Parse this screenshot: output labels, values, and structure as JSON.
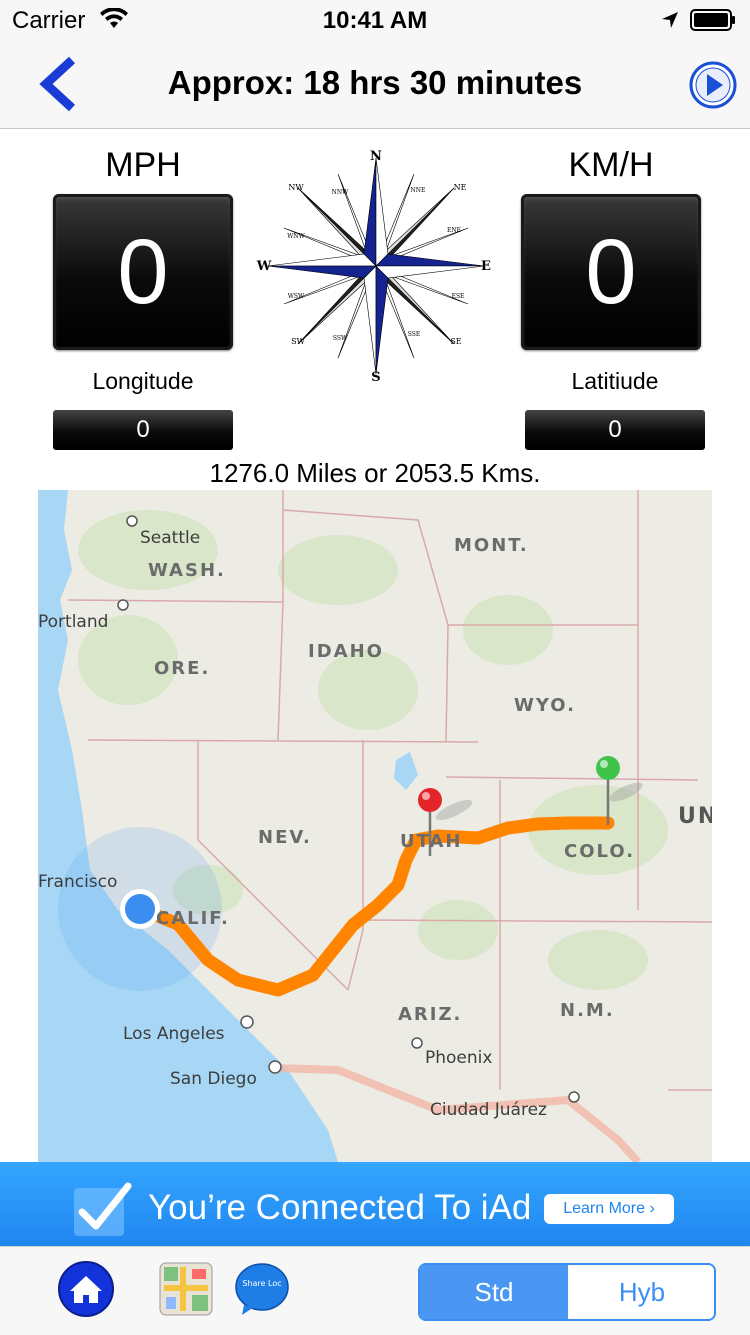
{
  "status_bar": {
    "carrier": "Carrier",
    "time": "10:41 AM",
    "icons": [
      "wifi-icon",
      "location-arrow-icon",
      "battery-icon"
    ]
  },
  "nav": {
    "title": "Approx: 18 hrs 30 minutes",
    "back_icon": "chevron-left-icon",
    "play_icon": "play-icon",
    "accent_color": "#1a3bd6"
  },
  "speed": {
    "mph_label": "MPH",
    "mph_value": "0",
    "kmh_label": "KM/H",
    "kmh_value": "0"
  },
  "coords": {
    "longitude_label": "Longitude",
    "longitude_value": "0",
    "latitude_label": "Latitiude",
    "latitude_value": "0"
  },
  "compass": {
    "cardinals": {
      "n": "N",
      "s": "S",
      "e": "E",
      "w": "W"
    },
    "intercardinals": {
      "ne": "NE",
      "nw": "NW",
      "se": "SE",
      "sw": "SW"
    },
    "minor": {
      "nne": "NNE",
      "ene": "ENE",
      "ese": "ESE",
      "sse": "SSE",
      "ssw": "SSW",
      "wsw": "WSW",
      "wnw": "WNW",
      "nnw": "NNW"
    }
  },
  "distance_text": "1276.0 Miles or 2053.5 Kms.",
  "map": {
    "states": {
      "wash": "WASH.",
      "ore": "ORE.",
      "idaho": "IDAHO",
      "mont": "MONT.",
      "wyo": "WYO.",
      "nev": "NEV.",
      "utah": "UTAH",
      "colo": "COLO.",
      "calif": "CALIF.",
      "ariz": "ARIZ.",
      "nm": "N.M.",
      "un": "UN"
    },
    "cities": {
      "seattle": "Seattle",
      "portland": "Portland",
      "san_francisco": "Francisco",
      "los_angeles": "Los Angeles",
      "san_diego": "San Diego",
      "phoenix": "Phoenix",
      "ciudad_juarez": "Ciudad Juárez"
    },
    "colors": {
      "route": "#ff8400",
      "start_pin": "#e5252a",
      "end_pin": "#3fc44b",
      "water": "#a7d7f5",
      "user_dot": "#3b8ef0"
    }
  },
  "ad": {
    "text": "You’re Connected To iAd",
    "button": "Learn More ›",
    "icon": "checkmark-icon"
  },
  "tab_bar": {
    "icons": [
      "home-icon",
      "map-icon",
      "share-location-icon"
    ],
    "share_icon_text": "Share Loc",
    "segments": [
      "Std",
      "Hyb"
    ],
    "selected_segment": "Std"
  }
}
